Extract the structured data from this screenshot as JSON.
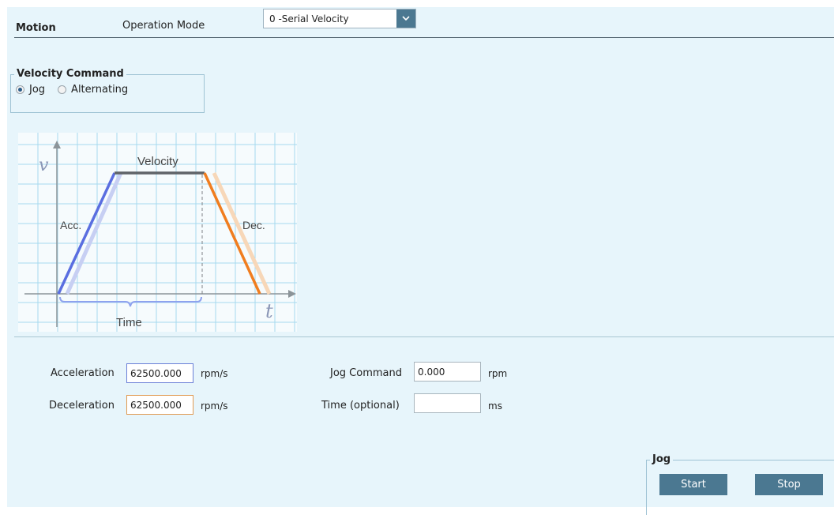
{
  "header": {
    "title": "Motion",
    "operation_mode_label": "Operation Mode",
    "operation_mode_value": "0 -Serial Velocity"
  },
  "velocity_command": {
    "legend": "Velocity Command",
    "options": [
      {
        "label": "Jog",
        "checked": true
      },
      {
        "label": "Alternating",
        "checked": false
      }
    ]
  },
  "diagram": {
    "v_axis": "v",
    "t_axis": "t",
    "velocity": "Velocity",
    "acc": "Acc.",
    "dec": "Dec.",
    "time": "Time",
    "colors": {
      "acc": "#5a6ee0",
      "dec": "#f07d1f",
      "flat": "#5f6368",
      "grid": "#a6d9ee"
    }
  },
  "fields": {
    "acceleration": {
      "label": "Acceleration",
      "value": "62500.000",
      "unit": "rpm/s"
    },
    "deceleration": {
      "label": "Deceleration",
      "value": "62500.000",
      "unit": "rpm/s"
    },
    "jog_command": {
      "label": "Jog Command",
      "value": "0.000",
      "unit": "rpm"
    },
    "time_optional": {
      "label": "Time (optional)",
      "value": "",
      "unit": "ms"
    }
  },
  "jog": {
    "legend": "Jog",
    "start_label": "Start",
    "stop_label": "Stop"
  }
}
